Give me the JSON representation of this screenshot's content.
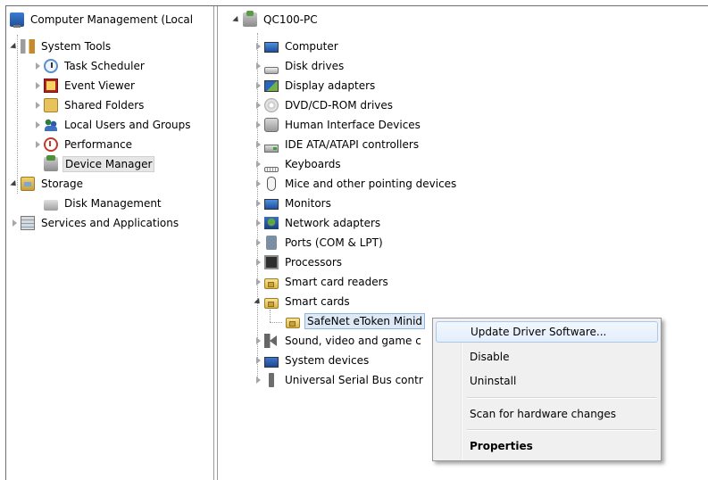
{
  "left_tree": {
    "root": "Computer Management (Local",
    "system_tools": "System Tools",
    "task_scheduler": "Task Scheduler",
    "event_viewer": "Event Viewer",
    "shared_folders": "Shared Folders",
    "local_users": "Local Users and Groups",
    "performance": "Performance",
    "device_manager": "Device Manager",
    "storage": "Storage",
    "disk_management": "Disk Management",
    "services_apps": "Services and Applications"
  },
  "right_tree": {
    "root": "QC100-PC",
    "categories": [
      "Computer",
      "Disk drives",
      "Display adapters",
      "DVD/CD-ROM drives",
      "Human Interface Devices",
      "IDE ATA/ATAPI controllers",
      "Keyboards",
      "Mice and other pointing devices",
      "Monitors",
      "Network adapters",
      "Ports (COM & LPT)",
      "Processors",
      "Smart card readers",
      "Smart cards"
    ],
    "smart_card_device": "SafeNet eToken Minid",
    "after_categories": [
      "Sound, video and game c",
      "System devices",
      "Universal Serial Bus contr"
    ]
  },
  "context_menu": {
    "update_driver": "Update Driver Software...",
    "disable": "Disable",
    "uninstall": "Uninstall",
    "scan": "Scan for hardware changes",
    "properties": "Properties"
  },
  "colors": {
    "menu_bg": "#f0f0f0",
    "highlight_border": "#a8c8ef",
    "selected_bg": "#e6e6e6"
  }
}
